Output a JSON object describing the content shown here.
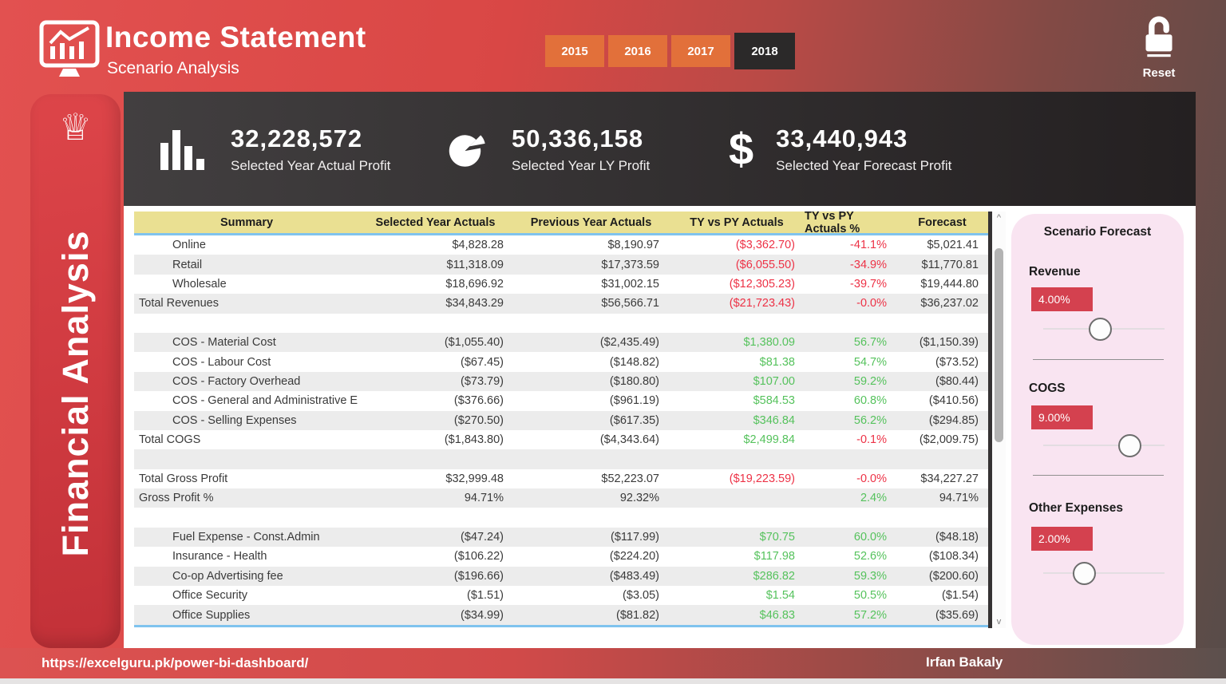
{
  "header": {
    "title": "Income Statement",
    "subtitle": "Scenario Analysis",
    "years": [
      "2015",
      "2016",
      "2017",
      "2018"
    ],
    "selected_year": "2018",
    "reset_label": "Reset"
  },
  "sidebar": {
    "label": "Financial Analysis",
    "crown_icon": "♕"
  },
  "kpis": [
    {
      "icon": "bar-chart-icon",
      "value": "32,228,572",
      "label": "Selected Year Actual Profit"
    },
    {
      "icon": "pie-chart-icon",
      "value": "50,336,158",
      "label": "Selected Year LY Profit"
    },
    {
      "icon": "dollar-icon",
      "dollar_glyph": "$",
      "value": "33,440,943",
      "label": "Selected Year Forecast Profit"
    }
  ],
  "table": {
    "columns": [
      "Summary",
      "Selected Year Actuals",
      "Previous Year Actuals",
      "TY vs PY Actuals",
      "TY vs PY Actuals %",
      "Forecast"
    ],
    "rows": [
      {
        "label": "Online",
        "indent": true,
        "values": [
          "$4,828.28",
          "$8,190.97",
          "($3,362.70)",
          "-41.1%",
          "$5,021.41"
        ],
        "cls": [
          "",
          "",
          "neg",
          "neg",
          ""
        ]
      },
      {
        "label": "Retail",
        "indent": true,
        "values": [
          "$11,318.09",
          "$17,373.59",
          "($6,055.50)",
          "-34.9%",
          "$11,770.81"
        ],
        "cls": [
          "",
          "",
          "neg",
          "neg",
          ""
        ]
      },
      {
        "label": "Wholesale",
        "indent": true,
        "values": [
          "$18,696.92",
          "$31,002.15",
          "($12,305.23)",
          "-39.7%",
          "$19,444.80"
        ],
        "cls": [
          "",
          "",
          "neg",
          "neg",
          ""
        ]
      },
      {
        "label": "Total Revenues",
        "indent": false,
        "values": [
          "$34,843.29",
          "$56,566.71",
          "($21,723.43)",
          "-0.0%",
          "$36,237.02"
        ],
        "cls": [
          "",
          "",
          "neg",
          "neg",
          ""
        ]
      },
      {
        "blank": true
      },
      {
        "label": "COS - Material Cost",
        "indent": true,
        "values": [
          "($1,055.40)",
          "($2,435.49)",
          "$1,380.09",
          "56.7%",
          "($1,150.39)"
        ],
        "cls": [
          "",
          "",
          "pos",
          "pos",
          ""
        ]
      },
      {
        "label": "COS - Labour Cost",
        "indent": true,
        "values": [
          "($67.45)",
          "($148.82)",
          "$81.38",
          "54.7%",
          "($73.52)"
        ],
        "cls": [
          "",
          "",
          "pos",
          "pos",
          ""
        ]
      },
      {
        "label": "COS - Factory Overhead",
        "indent": true,
        "values": [
          "($73.79)",
          "($180.80)",
          "$107.00",
          "59.2%",
          "($80.44)"
        ],
        "cls": [
          "",
          "",
          "pos",
          "pos",
          ""
        ]
      },
      {
        "label": "COS - General and Administrative Ex...",
        "indent": true,
        "values": [
          "($376.66)",
          "($961.19)",
          "$584.53",
          "60.8%",
          "($410.56)"
        ],
        "cls": [
          "",
          "",
          "pos",
          "pos",
          ""
        ]
      },
      {
        "label": "COS - Selling Expenses",
        "indent": true,
        "values": [
          "($270.50)",
          "($617.35)",
          "$346.84",
          "56.2%",
          "($294.85)"
        ],
        "cls": [
          "",
          "",
          "pos",
          "pos",
          ""
        ]
      },
      {
        "label": "Total COGS",
        "indent": false,
        "values": [
          "($1,843.80)",
          "($4,343.64)",
          "$2,499.84",
          "-0.1%",
          "($2,009.75)"
        ],
        "cls": [
          "",
          "",
          "pos",
          "neg",
          ""
        ]
      },
      {
        "blank": true
      },
      {
        "label": "Total Gross Profit",
        "indent": false,
        "values": [
          "$32,999.48",
          "$52,223.07",
          "($19,223.59)",
          "-0.0%",
          "$34,227.27"
        ],
        "cls": [
          "",
          "",
          "neg",
          "neg",
          ""
        ]
      },
      {
        "label": "Gross Profit %",
        "indent": false,
        "values": [
          "94.71%",
          "92.32%",
          "",
          "2.4%",
          "94.71%"
        ],
        "cls": [
          "",
          "",
          "",
          "pos",
          ""
        ]
      },
      {
        "blank": true
      },
      {
        "label": "Fuel Expense - Const.Admin",
        "indent": true,
        "values": [
          "($47.24)",
          "($117.99)",
          "$70.75",
          "60.0%",
          "($48.18)"
        ],
        "cls": [
          "",
          "",
          "pos",
          "pos",
          ""
        ]
      },
      {
        "label": "Insurance - Health",
        "indent": true,
        "values": [
          "($106.22)",
          "($224.20)",
          "$117.98",
          "52.6%",
          "($108.34)"
        ],
        "cls": [
          "",
          "",
          "pos",
          "pos",
          ""
        ]
      },
      {
        "label": "Co-op Advertising fee",
        "indent": true,
        "values": [
          "($196.66)",
          "($483.49)",
          "$286.82",
          "59.3%",
          "($200.60)"
        ],
        "cls": [
          "",
          "",
          "pos",
          "pos",
          ""
        ]
      },
      {
        "label": "Office Security",
        "indent": true,
        "values": [
          "($1.51)",
          "($3.05)",
          "$1.54",
          "50.5%",
          "($1.54)"
        ],
        "cls": [
          "",
          "",
          "pos",
          "pos",
          ""
        ]
      },
      {
        "label": "Office Supplies",
        "indent": true,
        "values": [
          "($34.99)",
          "($81.82)",
          "$46.83",
          "57.2%",
          "($35.69)"
        ],
        "cls": [
          "",
          "",
          "pos",
          "pos",
          ""
        ]
      }
    ]
  },
  "scenario": {
    "title": "Scenario Forecast",
    "sections": [
      {
        "label": "Revenue",
        "value": "4.00%"
      },
      {
        "label": "COGS",
        "value": "9.00%"
      },
      {
        "label": "Other Expenses",
        "value": "2.00%"
      }
    ]
  },
  "footer": {
    "url": "https://excelguru.pk/power-bi-dashboard/",
    "author": "Irfan Bakaly"
  },
  "colors": {
    "accent_red": "#d4414f",
    "positive_green": "#55c25c",
    "negative_red": "#ed3246",
    "table_header_yellow": "#eae092",
    "year_button_orange": "#e2703a",
    "selected_year_dark": "#2b2929",
    "panel_pink": "#f9e4f1",
    "banner_dark": "#2a2627"
  }
}
